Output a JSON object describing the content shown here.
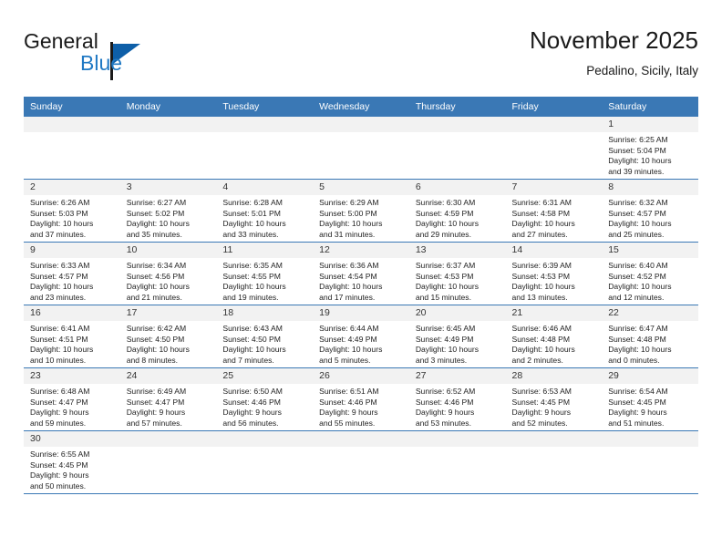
{
  "brand": {
    "name_top": "General",
    "name_bottom": "Blue",
    "accent_color": "#2079c4",
    "triangle_color": "#0e5fa8"
  },
  "header": {
    "month_title": "November 2025",
    "location": "Pedalino, Sicily, Italy"
  },
  "theme": {
    "header_bar_color": "#3a78b5",
    "daynum_strip_color": "#f2f2f2",
    "grid_line_color": "#3a78b5"
  },
  "weekdays": [
    "Sunday",
    "Monday",
    "Tuesday",
    "Wednesday",
    "Thursday",
    "Friday",
    "Saturday"
  ],
  "labels": {
    "sunrise_prefix": "Sunrise:",
    "sunset_prefix": "Sunset:",
    "daylight_prefix": "Daylight:"
  },
  "weeks": [
    [
      {
        "day": "",
        "blank": true
      },
      {
        "day": "",
        "blank": true
      },
      {
        "day": "",
        "blank": true
      },
      {
        "day": "",
        "blank": true
      },
      {
        "day": "",
        "blank": true
      },
      {
        "day": "",
        "blank": true
      },
      {
        "day": "1",
        "sunrise": "Sunrise: 6:25 AM",
        "sunset": "Sunset: 5:04 PM",
        "daylight_line1": "Daylight: 10 hours",
        "daylight_line2": "and 39 minutes."
      }
    ],
    [
      {
        "day": "2",
        "sunrise": "Sunrise: 6:26 AM",
        "sunset": "Sunset: 5:03 PM",
        "daylight_line1": "Daylight: 10 hours",
        "daylight_line2": "and 37 minutes."
      },
      {
        "day": "3",
        "sunrise": "Sunrise: 6:27 AM",
        "sunset": "Sunset: 5:02 PM",
        "daylight_line1": "Daylight: 10 hours",
        "daylight_line2": "and 35 minutes."
      },
      {
        "day": "4",
        "sunrise": "Sunrise: 6:28 AM",
        "sunset": "Sunset: 5:01 PM",
        "daylight_line1": "Daylight: 10 hours",
        "daylight_line2": "and 33 minutes."
      },
      {
        "day": "5",
        "sunrise": "Sunrise: 6:29 AM",
        "sunset": "Sunset: 5:00 PM",
        "daylight_line1": "Daylight: 10 hours",
        "daylight_line2": "and 31 minutes."
      },
      {
        "day": "6",
        "sunrise": "Sunrise: 6:30 AM",
        "sunset": "Sunset: 4:59 PM",
        "daylight_line1": "Daylight: 10 hours",
        "daylight_line2": "and 29 minutes."
      },
      {
        "day": "7",
        "sunrise": "Sunrise: 6:31 AM",
        "sunset": "Sunset: 4:58 PM",
        "daylight_line1": "Daylight: 10 hours",
        "daylight_line2": "and 27 minutes."
      },
      {
        "day": "8",
        "sunrise": "Sunrise: 6:32 AM",
        "sunset": "Sunset: 4:57 PM",
        "daylight_line1": "Daylight: 10 hours",
        "daylight_line2": "and 25 minutes."
      }
    ],
    [
      {
        "day": "9",
        "sunrise": "Sunrise: 6:33 AM",
        "sunset": "Sunset: 4:57 PM",
        "daylight_line1": "Daylight: 10 hours",
        "daylight_line2": "and 23 minutes."
      },
      {
        "day": "10",
        "sunrise": "Sunrise: 6:34 AM",
        "sunset": "Sunset: 4:56 PM",
        "daylight_line1": "Daylight: 10 hours",
        "daylight_line2": "and 21 minutes."
      },
      {
        "day": "11",
        "sunrise": "Sunrise: 6:35 AM",
        "sunset": "Sunset: 4:55 PM",
        "daylight_line1": "Daylight: 10 hours",
        "daylight_line2": "and 19 minutes."
      },
      {
        "day": "12",
        "sunrise": "Sunrise: 6:36 AM",
        "sunset": "Sunset: 4:54 PM",
        "daylight_line1": "Daylight: 10 hours",
        "daylight_line2": "and 17 minutes."
      },
      {
        "day": "13",
        "sunrise": "Sunrise: 6:37 AM",
        "sunset": "Sunset: 4:53 PM",
        "daylight_line1": "Daylight: 10 hours",
        "daylight_line2": "and 15 minutes."
      },
      {
        "day": "14",
        "sunrise": "Sunrise: 6:39 AM",
        "sunset": "Sunset: 4:53 PM",
        "daylight_line1": "Daylight: 10 hours",
        "daylight_line2": "and 13 minutes."
      },
      {
        "day": "15",
        "sunrise": "Sunrise: 6:40 AM",
        "sunset": "Sunset: 4:52 PM",
        "daylight_line1": "Daylight: 10 hours",
        "daylight_line2": "and 12 minutes."
      }
    ],
    [
      {
        "day": "16",
        "sunrise": "Sunrise: 6:41 AM",
        "sunset": "Sunset: 4:51 PM",
        "daylight_line1": "Daylight: 10 hours",
        "daylight_line2": "and 10 minutes."
      },
      {
        "day": "17",
        "sunrise": "Sunrise: 6:42 AM",
        "sunset": "Sunset: 4:50 PM",
        "daylight_line1": "Daylight: 10 hours",
        "daylight_line2": "and 8 minutes."
      },
      {
        "day": "18",
        "sunrise": "Sunrise: 6:43 AM",
        "sunset": "Sunset: 4:50 PM",
        "daylight_line1": "Daylight: 10 hours",
        "daylight_line2": "and 7 minutes."
      },
      {
        "day": "19",
        "sunrise": "Sunrise: 6:44 AM",
        "sunset": "Sunset: 4:49 PM",
        "daylight_line1": "Daylight: 10 hours",
        "daylight_line2": "and 5 minutes."
      },
      {
        "day": "20",
        "sunrise": "Sunrise: 6:45 AM",
        "sunset": "Sunset: 4:49 PM",
        "daylight_line1": "Daylight: 10 hours",
        "daylight_line2": "and 3 minutes."
      },
      {
        "day": "21",
        "sunrise": "Sunrise: 6:46 AM",
        "sunset": "Sunset: 4:48 PM",
        "daylight_line1": "Daylight: 10 hours",
        "daylight_line2": "and 2 minutes."
      },
      {
        "day": "22",
        "sunrise": "Sunrise: 6:47 AM",
        "sunset": "Sunset: 4:48 PM",
        "daylight_line1": "Daylight: 10 hours",
        "daylight_line2": "and 0 minutes."
      }
    ],
    [
      {
        "day": "23",
        "sunrise": "Sunrise: 6:48 AM",
        "sunset": "Sunset: 4:47 PM",
        "daylight_line1": "Daylight: 9 hours",
        "daylight_line2": "and 59 minutes."
      },
      {
        "day": "24",
        "sunrise": "Sunrise: 6:49 AM",
        "sunset": "Sunset: 4:47 PM",
        "daylight_line1": "Daylight: 9 hours",
        "daylight_line2": "and 57 minutes."
      },
      {
        "day": "25",
        "sunrise": "Sunrise: 6:50 AM",
        "sunset": "Sunset: 4:46 PM",
        "daylight_line1": "Daylight: 9 hours",
        "daylight_line2": "and 56 minutes."
      },
      {
        "day": "26",
        "sunrise": "Sunrise: 6:51 AM",
        "sunset": "Sunset: 4:46 PM",
        "daylight_line1": "Daylight: 9 hours",
        "daylight_line2": "and 55 minutes."
      },
      {
        "day": "27",
        "sunrise": "Sunrise: 6:52 AM",
        "sunset": "Sunset: 4:46 PM",
        "daylight_line1": "Daylight: 9 hours",
        "daylight_line2": "and 53 minutes."
      },
      {
        "day": "28",
        "sunrise": "Sunrise: 6:53 AM",
        "sunset": "Sunset: 4:45 PM",
        "daylight_line1": "Daylight: 9 hours",
        "daylight_line2": "and 52 minutes."
      },
      {
        "day": "29",
        "sunrise": "Sunrise: 6:54 AM",
        "sunset": "Sunset: 4:45 PM",
        "daylight_line1": "Daylight: 9 hours",
        "daylight_line2": "and 51 minutes."
      }
    ],
    [
      {
        "day": "30",
        "sunrise": "Sunrise: 6:55 AM",
        "sunset": "Sunset: 4:45 PM",
        "daylight_line1": "Daylight: 9 hours",
        "daylight_line2": "and 50 minutes."
      },
      {
        "day": "",
        "blank": true
      },
      {
        "day": "",
        "blank": true
      },
      {
        "day": "",
        "blank": true
      },
      {
        "day": "",
        "blank": true
      },
      {
        "day": "",
        "blank": true
      },
      {
        "day": "",
        "blank": true
      }
    ]
  ]
}
